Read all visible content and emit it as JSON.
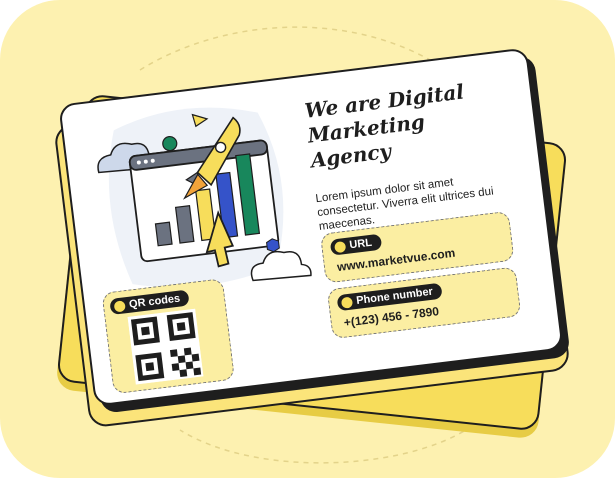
{
  "headline": "We are Digital Marketing Agency",
  "description": "Lorem ipsum dolor sit amet consectetur. Viverra elit ultrices dui maecenas.",
  "qr": {
    "label": "QR codes",
    "icon": "qr-icon"
  },
  "url": {
    "label": "URL",
    "value": "www.marketvue.com",
    "icon": "globe-icon"
  },
  "phone": {
    "label": "Phone number",
    "value": "+(123) 456 - 7890",
    "icon": "phone-icon"
  },
  "colors": {
    "background": "#fdf1b0",
    "card": "#ffffff",
    "accent_yellow": "#f7dd5b",
    "accent_blue": "#3553c9",
    "accent_green": "#18875c",
    "ink": "#1e1e1e"
  }
}
